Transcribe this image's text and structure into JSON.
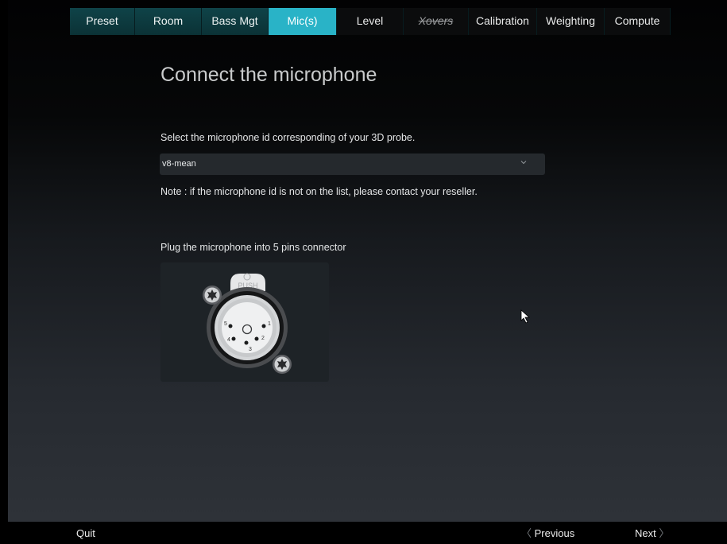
{
  "tabs": [
    {
      "label": "Preset",
      "state": "normal"
    },
    {
      "label": "Room",
      "state": "normal"
    },
    {
      "label": "Bass Mgt",
      "state": "normal"
    },
    {
      "label": "Mic(s)",
      "state": "active"
    },
    {
      "label": "Level",
      "state": "inactive"
    },
    {
      "label": "Xovers",
      "state": "disabled"
    },
    {
      "label": "Calibration",
      "state": "inactive"
    },
    {
      "label": "Weighting",
      "state": "inactive"
    },
    {
      "label": "Compute",
      "state": "inactive"
    }
  ],
  "page": {
    "title": "Connect the microphone",
    "instruction": "Select the microphone id corresponding of your 3D probe.",
    "note": "Note : if the microphone id is not on the list, please contact your reseller.",
    "plug_instruction": "Plug the microphone into 5 pins connector"
  },
  "mic_select": {
    "value": "v8-mean",
    "icon": "chevron-down-icon"
  },
  "connector": {
    "latch_label": "PUSH",
    "pins": [
      "1",
      "2",
      "3",
      "4",
      "5"
    ]
  },
  "footer": {
    "quit": "Quit",
    "previous": "Previous",
    "next": "Next",
    "previous_glyph": "〈",
    "next_glyph": "〉"
  },
  "colors": {
    "tab_normal": "#0f4348",
    "tab_active": "#29b3c7",
    "tab_inactive": "#0b0c0d",
    "background_dark": "#020203",
    "background_light": "#2e3238"
  }
}
